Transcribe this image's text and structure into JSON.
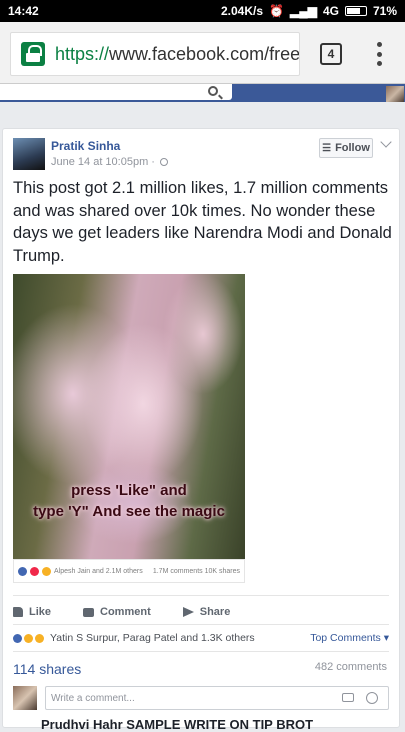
{
  "status": {
    "time": "14:42",
    "speed": "2.04K/s",
    "network": "4G",
    "battery": "71%"
  },
  "browser": {
    "url_scheme": "https://",
    "url_rest": "www.facebook.com/free",
    "tab_count": "4"
  },
  "post": {
    "author": "Pratik Sinha",
    "timestamp": "June 14 at 10:05pm · ",
    "follow_label": "Follow",
    "text": "This post got 2.1 million likes, 1.7 million comments and was shared over 10k times. No wonder these days we get leaders like Narendra Modi and Donald Trump.",
    "photo": {
      "overlay_line1": "press 'Like\" and",
      "overlay_line2": "type 'Y\" And see the magic",
      "footer_reactions": "Alpesh Jain and 2.1M others",
      "footer_stats": "1.7M comments  10K shares"
    },
    "actions": {
      "like": "Like",
      "comment": "Comment",
      "share": "Share"
    },
    "reactions_text": "Yatin S Surpur, Parag Patel and 1.3K others",
    "top_comments": "Top Comments",
    "shares": "114 shares",
    "comments": "482 comments",
    "comment_placeholder": "Write a comment...",
    "next_line": "Prudhvi Hahr  SAMPLE WRITE ON TIP BROT"
  },
  "colors": {
    "fb_blue": "#3b5998",
    "link": "#365899",
    "secure_green": "#0b8043"
  }
}
